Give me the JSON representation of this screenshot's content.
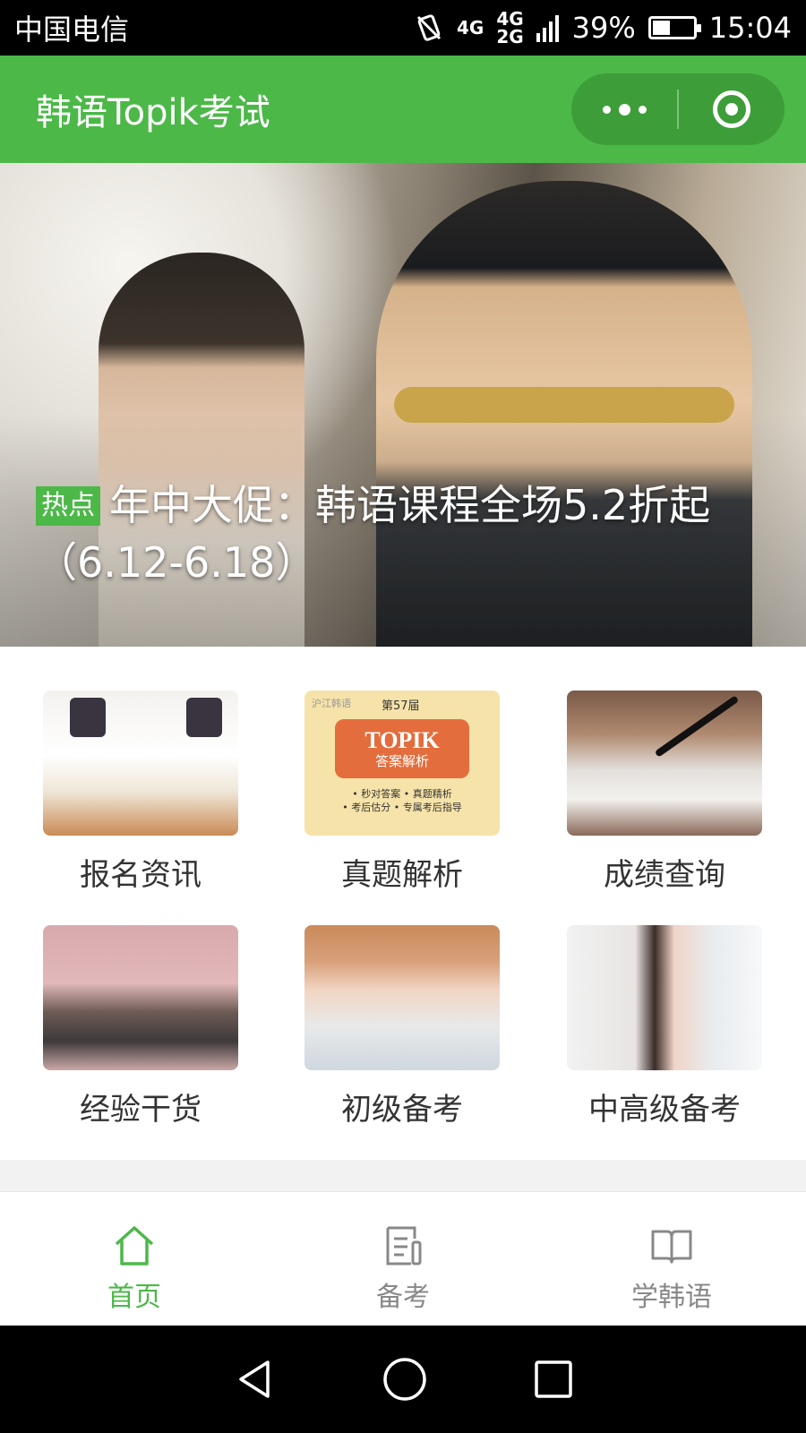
{
  "status_bar": {
    "carrier": "中国电信",
    "network_top": "4G",
    "network_bottom": "2G",
    "battery": "39%",
    "battery_level": 0.39,
    "time": "15:04"
  },
  "header": {
    "title": "韩语Topik考试"
  },
  "banner": {
    "tag": "热点",
    "headline": "年中大促：韩语课程全场5.2折起（6.12-6.18）"
  },
  "grid": [
    {
      "label": "报名资讯"
    },
    {
      "label": "真题解析",
      "thumb": {
        "brand": "沪江韩语",
        "issue": "第57届",
        "title": "TOPIK",
        "subtitle": "答案解析",
        "line1": "• 秒对答案  • 真题精析",
        "line2": "• 考后估分  • 专属考后指导"
      }
    },
    {
      "label": "成绩查询"
    },
    {
      "label": "经验干货"
    },
    {
      "label": "初级备考"
    },
    {
      "label": "中高级备考"
    }
  ],
  "tabbar": [
    {
      "label": "首页",
      "icon": "home-icon",
      "active": true
    },
    {
      "label": "备考",
      "icon": "notes-icon",
      "active": false
    },
    {
      "label": "学韩语",
      "icon": "book-icon",
      "active": false
    }
  ],
  "colors": {
    "accent": "#4cb848",
    "tag_bg": "#4cb848",
    "inactive_tab": "#888888"
  }
}
